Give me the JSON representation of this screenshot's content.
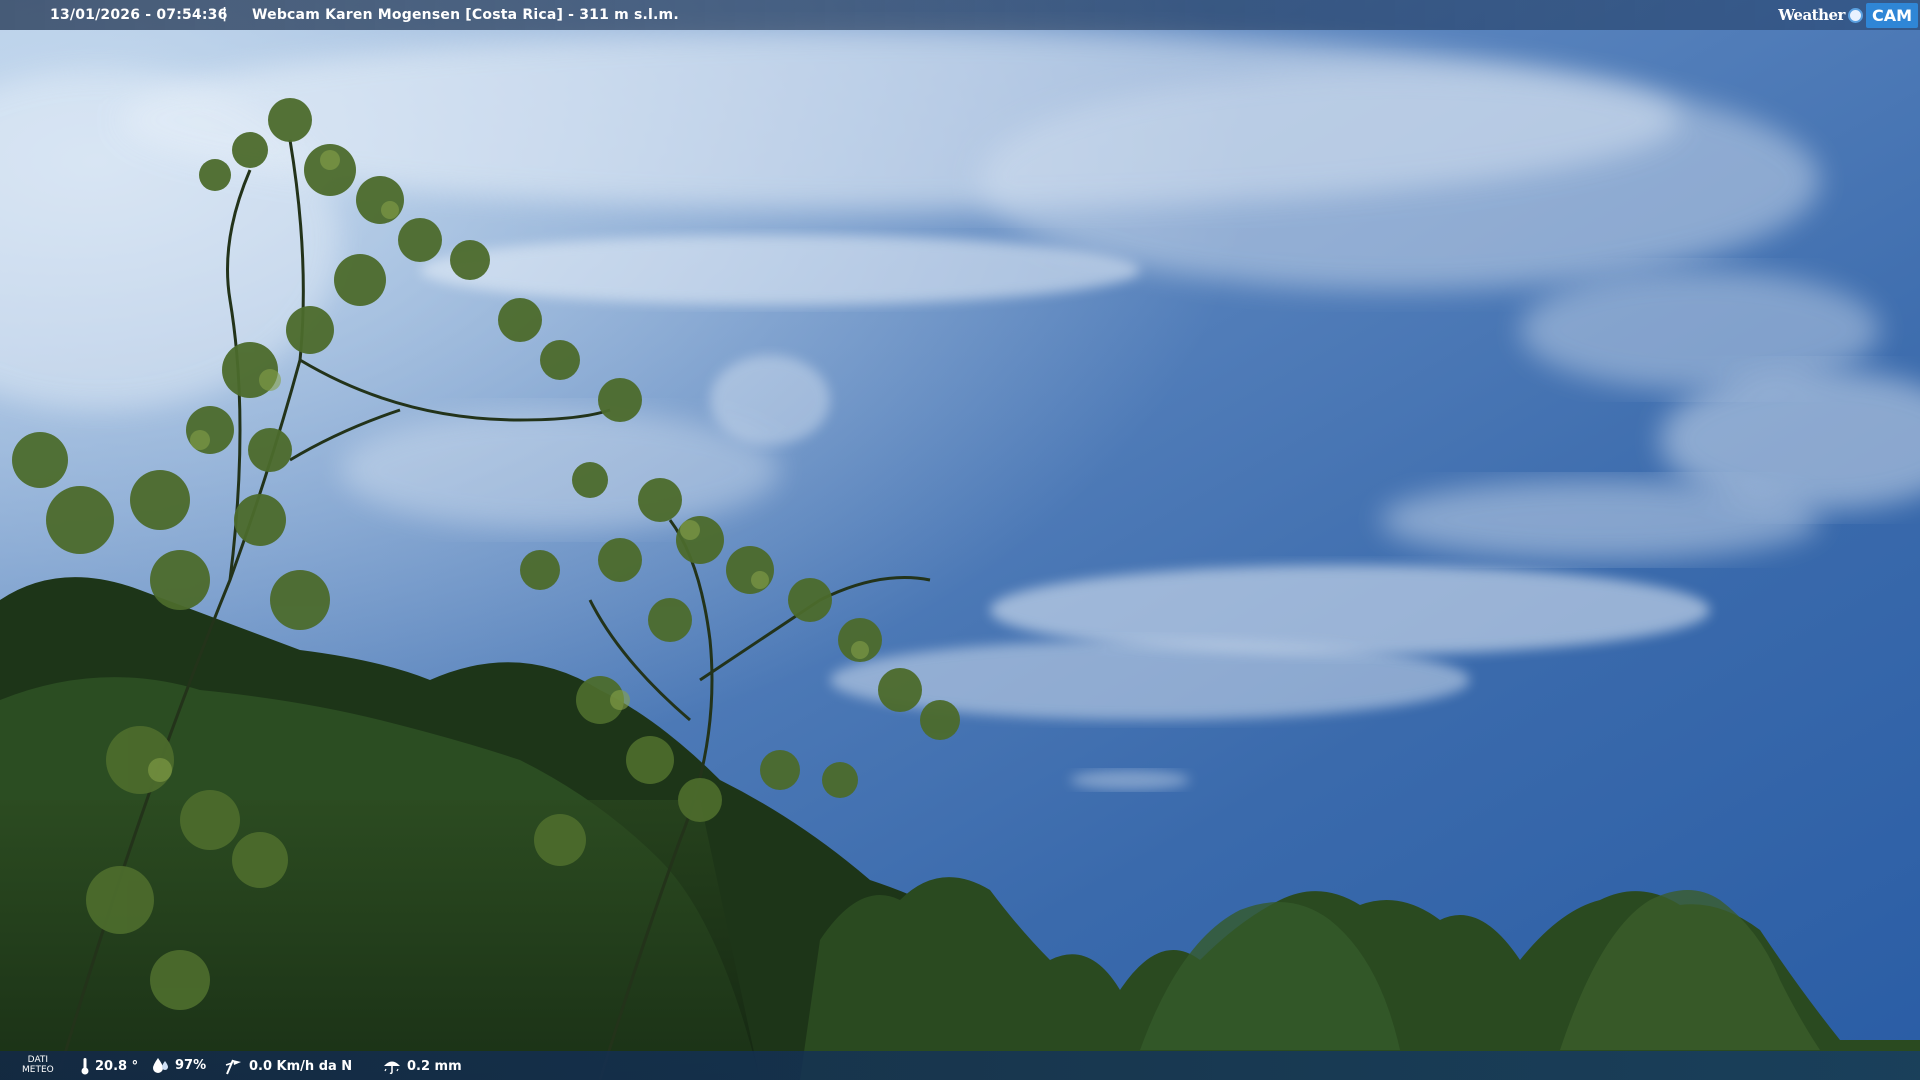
{
  "header": {
    "timestamp": "13/01/2026 - 07:54:36",
    "separator": "|",
    "title": "Webcam Karen Mogensen [Costa Rica]  - 311 m s.l.m."
  },
  "logo": {
    "word": "Weather",
    "badge": "CAM",
    "dot_icon": "globe-dot-icon"
  },
  "weather": {
    "label_line1": "DATI",
    "label_line2": "METEO",
    "temperature": "20.8 °",
    "humidity": "97%",
    "wind": "0.0 Km/h da N",
    "rain": "0.2 mm",
    "icons": [
      "thermometer-icon",
      "humidity-drop-icon",
      "wind-icon",
      "rain-umbrella-icon"
    ]
  },
  "colors": {
    "sky_top": "#6f97c8",
    "sky_mid": "#3c6aa6",
    "sky_bottom": "#2e62a8",
    "foliage": "#1f3a1a",
    "accent": "#2f86d6"
  }
}
